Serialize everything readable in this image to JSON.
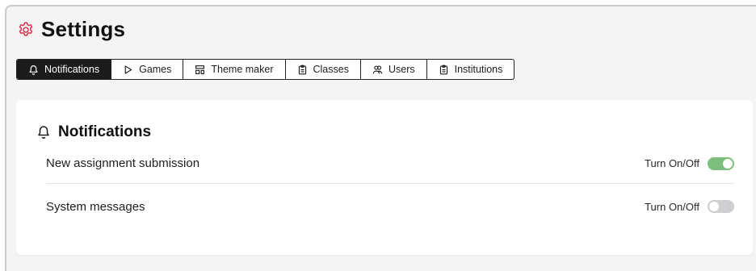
{
  "colors": {
    "accent": "#e0314f",
    "toggle_on": "#7cbf7c",
    "toggle_off": "#cfcfd2",
    "tab_active_bg": "#1b1b1b"
  },
  "header": {
    "icon": "gear-icon",
    "title": "Settings"
  },
  "tabs": [
    {
      "label": "Notifications",
      "icon": "bell-icon",
      "active": true
    },
    {
      "label": "Games",
      "icon": "play-icon",
      "active": false
    },
    {
      "label": "Theme maker",
      "icon": "layout-icon",
      "active": false
    },
    {
      "label": "Classes",
      "icon": "clipboard-icon",
      "active": false
    },
    {
      "label": "Users",
      "icon": "users-icon",
      "active": false
    },
    {
      "label": "Institutions",
      "icon": "clipboard-icon",
      "active": false
    }
  ],
  "section": {
    "icon": "bell-icon",
    "title": "Notifications",
    "rows": [
      {
        "label": "New assignment submission",
        "toggle_text": "Turn On/Off",
        "enabled": true
      },
      {
        "label": "System messages",
        "toggle_text": "Turn On/Off",
        "enabled": false
      }
    ]
  }
}
